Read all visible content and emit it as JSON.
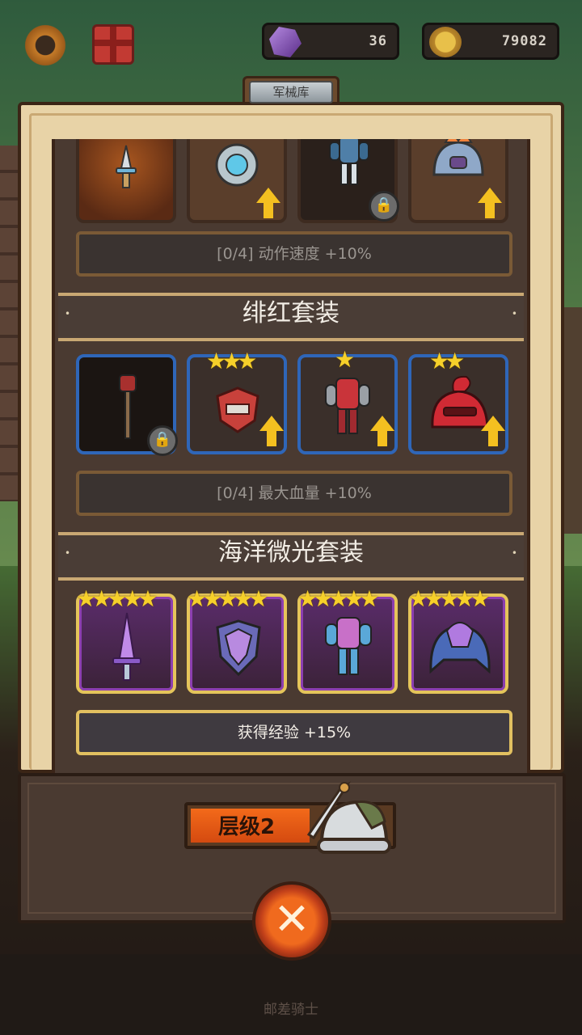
{
  "hud": {
    "gems": "36",
    "coins": "79082",
    "settings_icon": "gear-icon",
    "gift_icon": "gift-icon"
  },
  "armory": {
    "title": "军械库"
  },
  "sets": [
    {
      "name": "",
      "bonus": "[0/4] 动作速度 +10%",
      "items": [
        {
          "icon": "dagger-icon",
          "stars": 0,
          "upgrade": false,
          "locked": false
        },
        {
          "icon": "round-shield-icon",
          "stars": 0,
          "upgrade": true,
          "locked": false
        },
        {
          "icon": "armor-icon",
          "stars": 0,
          "upgrade": false,
          "locked": true
        },
        {
          "icon": "helmet-icon",
          "stars": 0,
          "upgrade": true,
          "locked": false
        }
      ]
    },
    {
      "name": "绯红套装",
      "bonus": "[0/4] 最大血量 +10%",
      "items": [
        {
          "icon": "mace-icon",
          "stars": 0,
          "upgrade": false,
          "locked": true
        },
        {
          "icon": "shield-icon",
          "stars": 3,
          "upgrade": true,
          "locked": false
        },
        {
          "icon": "armor-icon",
          "stars": 1,
          "upgrade": true,
          "locked": false
        },
        {
          "icon": "helmet-icon",
          "stars": 2,
          "upgrade": true,
          "locked": false
        }
      ]
    },
    {
      "name": "海洋微光套装",
      "bonus": "获得经验 +15%",
      "items": [
        {
          "icon": "sword-icon",
          "stars": 5,
          "upgrade": false,
          "locked": false
        },
        {
          "icon": "shield-icon",
          "stars": 5,
          "upgrade": false,
          "locked": false
        },
        {
          "icon": "armor-icon",
          "stars": 5,
          "upgrade": false,
          "locked": false
        },
        {
          "icon": "helmet-icon",
          "stars": 5,
          "upgrade": false,
          "locked": false
        }
      ]
    }
  ],
  "tier": {
    "label": "层级2",
    "progress": 0.58
  },
  "close_icon": "close-icon",
  "footer": "邮差骑士",
  "colors": {
    "frame": "#e8d3a7",
    "common_border": "#3e2b20",
    "rare_border": "#2f66b8",
    "epic_border": "#e5c55a",
    "star": "#f6d02a",
    "upgrade_arrow": "#f4c020",
    "tier_fill": "#f36a1a"
  }
}
